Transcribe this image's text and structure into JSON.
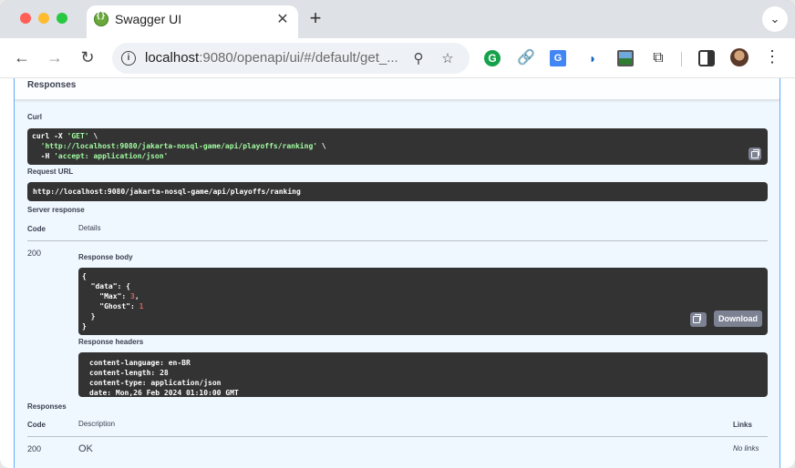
{
  "browser": {
    "tab_title": "Swagger UI",
    "url_host": "localhost",
    "url_path": ":9080/openapi/ui/#/default/get_..."
  },
  "responses_header": "Responses",
  "curl": {
    "label": "Curl",
    "line1": "curl -X ",
    "method": "'GET'",
    "line1_tail": " \\",
    "url": "'http://localhost:9080/jakarta-nosql-game/api/playoffs/ranking'",
    "url_tail": " \\",
    "line3_head": "  -H ",
    "accept": "'accept: application/json'"
  },
  "request_url": {
    "label": "Request URL",
    "value": "http://localhost:9080/jakarta-nosql-game/api/playoffs/ranking"
  },
  "server_response": {
    "label": "Server response",
    "col_code": "Code",
    "col_details": "Details",
    "code": "200",
    "body_label": "Response body",
    "body": {
      "open": "{",
      "data_key": "\"data\"",
      "max_key": "\"Max\"",
      "max_val": "3",
      "ghost_key": "\"Ghost\"",
      "ghost_val": "1",
      "inner_close": "  }",
      "close": "}"
    },
    "download_label": "Download",
    "headers_label": "Response headers",
    "headers": [
      "content-language: en-BR",
      "content-length: 28",
      "content-type: application/json",
      "date: Mon,26 Feb 2024 01:10:00 GMT"
    ]
  },
  "responses": {
    "label": "Responses",
    "col_code": "Code",
    "col_description": "Description",
    "col_links": "Links",
    "rows": [
      {
        "code": "200",
        "description": "OK",
        "links": "No links"
      }
    ]
  },
  "colors": {
    "accent": "#61affe",
    "code_bg": "#333333",
    "string": "#a2fca2",
    "number": "#d36363"
  }
}
